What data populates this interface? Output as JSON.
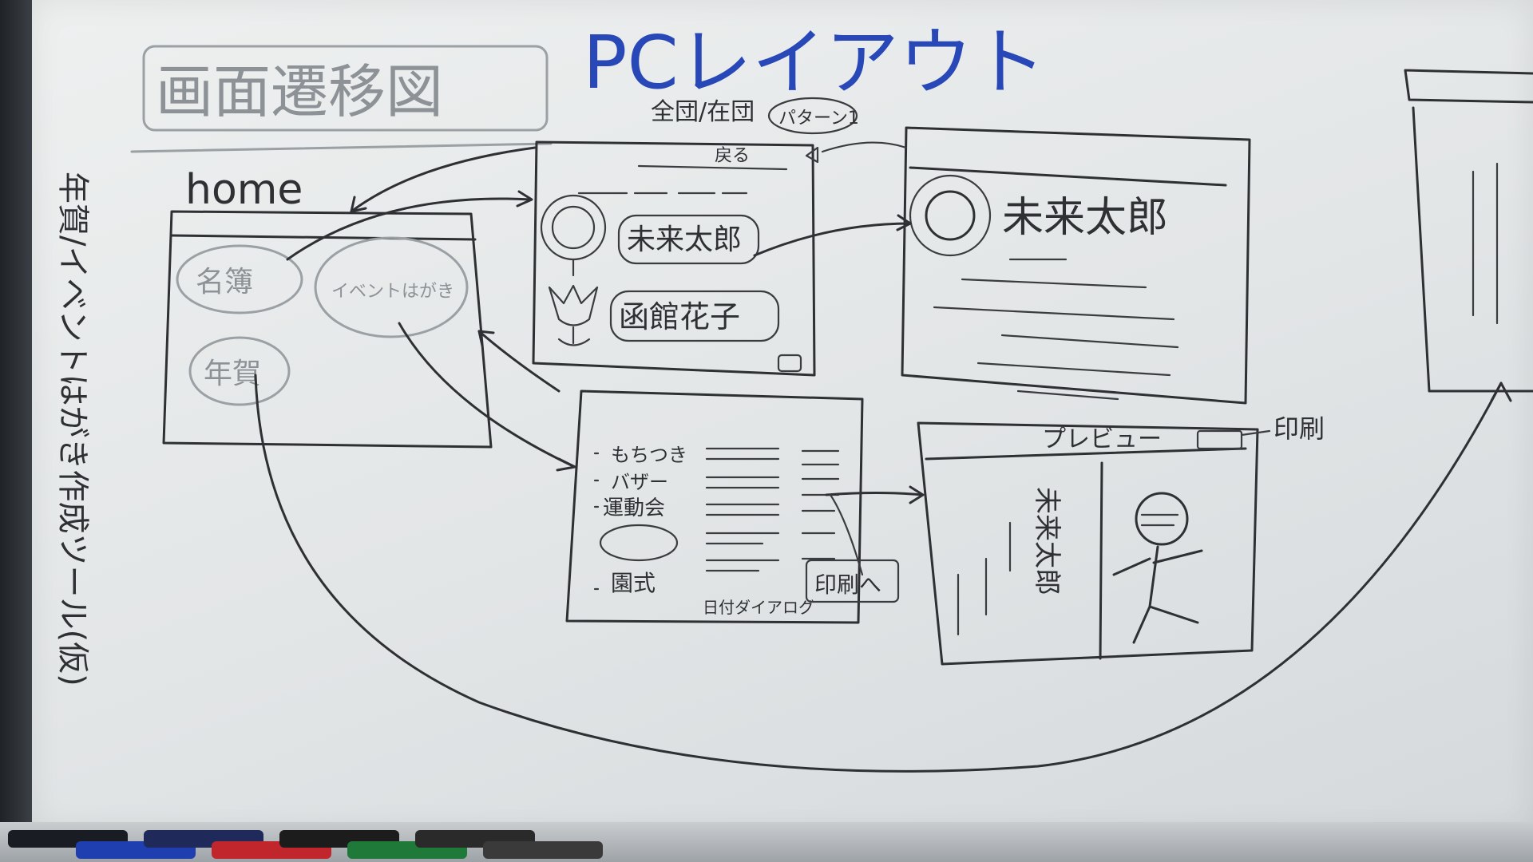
{
  "board": {
    "title": "画面遷移図",
    "subtitle": "PCレイアウト",
    "side_label": "年賀/イベントはがき作成ツール(仮)"
  },
  "home": {
    "label": "home",
    "buttons": [
      "名簿",
      "イベントはがき",
      "年賀"
    ]
  },
  "list_screen": {
    "note": "全団/在団",
    "pattern": "パターン1",
    "back": "戻る",
    "names": [
      "未来太郎",
      "函館花子"
    ]
  },
  "detail_screen": {
    "name": "未来太郎"
  },
  "event_screen": {
    "items": [
      "もちつき",
      "バザー",
      "運動会",
      "園式"
    ],
    "date_dialog": "日付ダイアログ",
    "print_button": "印刷へ"
  },
  "preview_screen": {
    "title": "プレビュー",
    "print_label": "印刷",
    "vertical_name": "未来太郎"
  },
  "markers": {
    "colors": [
      "#1a1c24",
      "#1f3fb0",
      "#202a5a",
      "#c0262c",
      "#1c1c1c",
      "#1f7a3a",
      "#2a2a2a",
      "#3a3a3a"
    ]
  }
}
